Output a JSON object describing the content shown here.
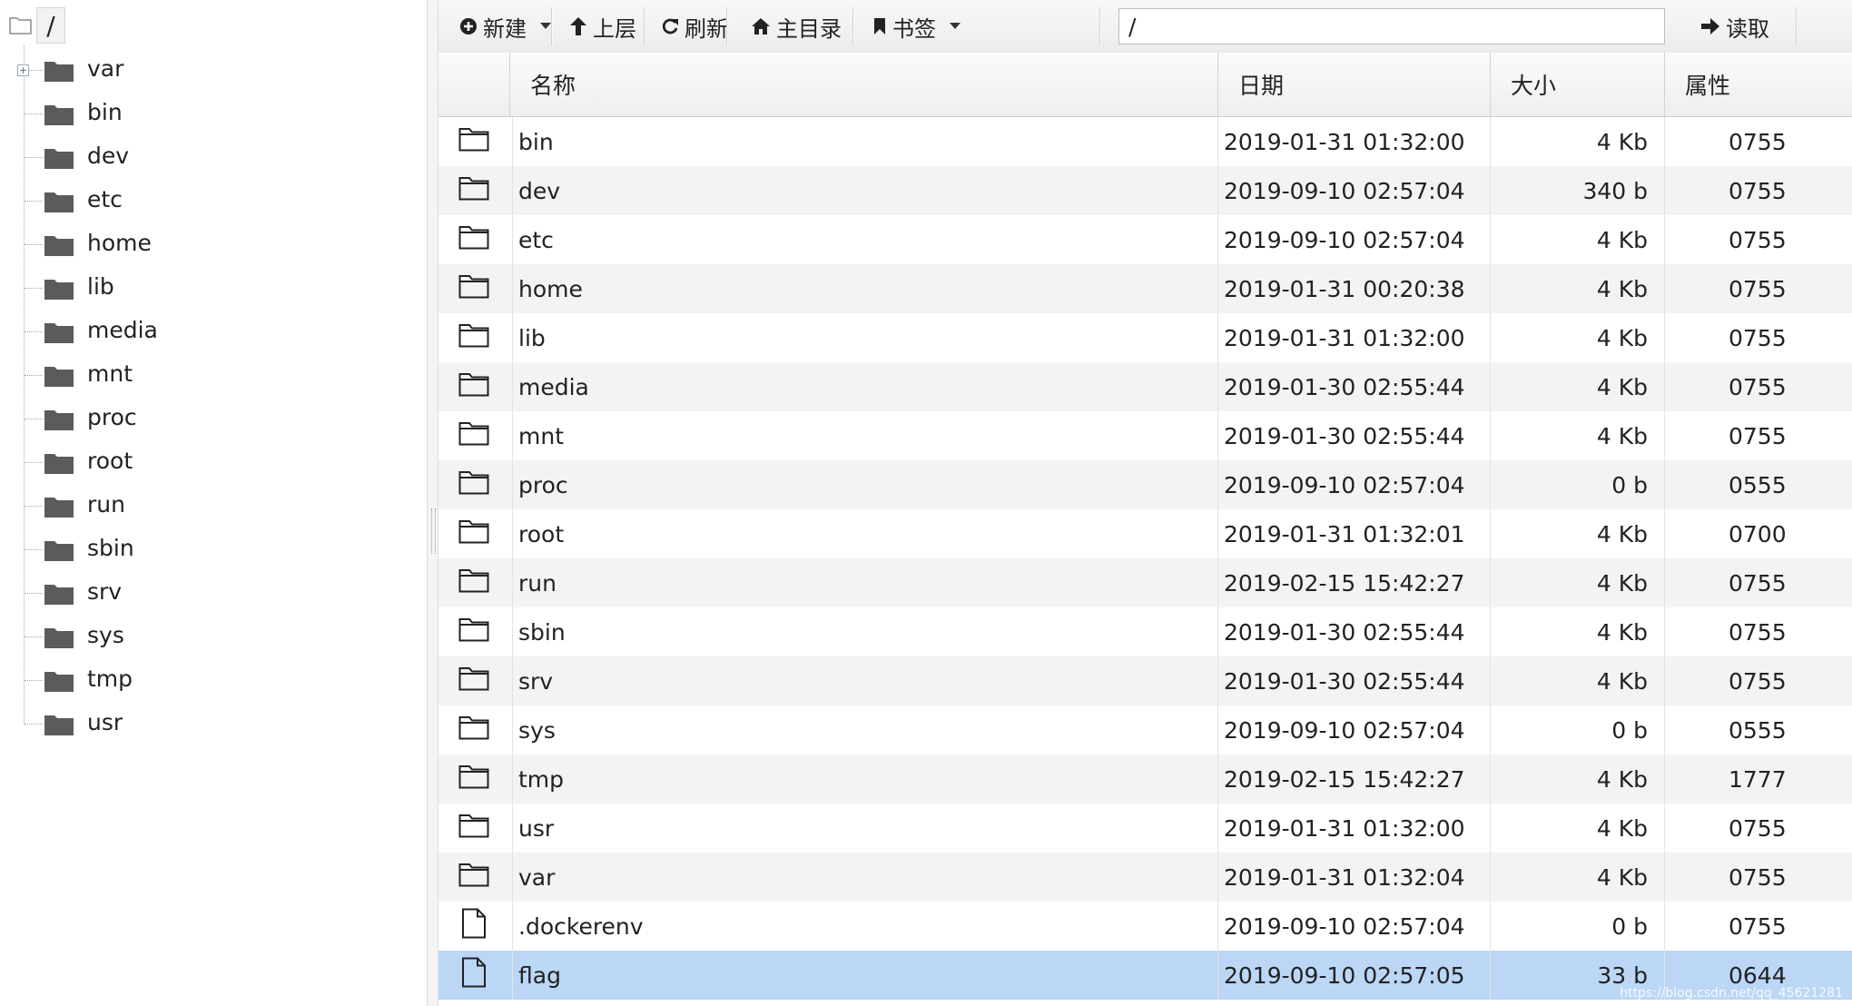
{
  "tree": {
    "root_label": "/",
    "items": [
      {
        "label": "var",
        "expandable": true
      },
      {
        "label": "bin"
      },
      {
        "label": "dev"
      },
      {
        "label": "etc"
      },
      {
        "label": "home"
      },
      {
        "label": "lib"
      },
      {
        "label": "media"
      },
      {
        "label": "mnt"
      },
      {
        "label": "proc"
      },
      {
        "label": "root"
      },
      {
        "label": "run"
      },
      {
        "label": "sbin"
      },
      {
        "label": "srv"
      },
      {
        "label": "sys"
      },
      {
        "label": "tmp"
      },
      {
        "label": "usr"
      }
    ]
  },
  "toolbar": {
    "new_label": "新建",
    "up_label": "上层",
    "refresh_label": "刷新",
    "home_label": "主目录",
    "bookmark_label": "书签",
    "path_value": "/",
    "read_label": "读取"
  },
  "grid": {
    "headers": {
      "name": "名称",
      "date": "日期",
      "size": "大小",
      "attr": "属性"
    },
    "rows": [
      {
        "type": "folder",
        "name": "bin",
        "date": "2019-01-31 01:32:00",
        "size": "4 Kb",
        "attr": "0755"
      },
      {
        "type": "folder",
        "name": "dev",
        "date": "2019-09-10 02:57:04",
        "size": "340 b",
        "attr": "0755"
      },
      {
        "type": "folder",
        "name": "etc",
        "date": "2019-09-10 02:57:04",
        "size": "4 Kb",
        "attr": "0755"
      },
      {
        "type": "folder",
        "name": "home",
        "date": "2019-01-31 00:20:38",
        "size": "4 Kb",
        "attr": "0755"
      },
      {
        "type": "folder",
        "name": "lib",
        "date": "2019-01-31 01:32:00",
        "size": "4 Kb",
        "attr": "0755"
      },
      {
        "type": "folder",
        "name": "media",
        "date": "2019-01-30 02:55:44",
        "size": "4 Kb",
        "attr": "0755"
      },
      {
        "type": "folder",
        "name": "mnt",
        "date": "2019-01-30 02:55:44",
        "size": "4 Kb",
        "attr": "0755"
      },
      {
        "type": "folder",
        "name": "proc",
        "date": "2019-09-10 02:57:04",
        "size": "0 b",
        "attr": "0555"
      },
      {
        "type": "folder",
        "name": "root",
        "date": "2019-01-31 01:32:01",
        "size": "4 Kb",
        "attr": "0700"
      },
      {
        "type": "folder",
        "name": "run",
        "date": "2019-02-15 15:42:27",
        "size": "4 Kb",
        "attr": "0755"
      },
      {
        "type": "folder",
        "name": "sbin",
        "date": "2019-01-30 02:55:44",
        "size": "4 Kb",
        "attr": "0755"
      },
      {
        "type": "folder",
        "name": "srv",
        "date": "2019-01-30 02:55:44",
        "size": "4 Kb",
        "attr": "0755"
      },
      {
        "type": "folder",
        "name": "sys",
        "date": "2019-09-10 02:57:04",
        "size": "0 b",
        "attr": "0555"
      },
      {
        "type": "folder",
        "name": "tmp",
        "date": "2019-02-15 15:42:27",
        "size": "4 Kb",
        "attr": "1777"
      },
      {
        "type": "folder",
        "name": "usr",
        "date": "2019-01-31 01:32:00",
        "size": "4 Kb",
        "attr": "0755"
      },
      {
        "type": "folder",
        "name": "var",
        "date": "2019-01-31 01:32:04",
        "size": "4 Kb",
        "attr": "0755"
      },
      {
        "type": "file",
        "name": ".dockerenv",
        "date": "2019-09-10 02:57:04",
        "size": "0 b",
        "attr": "0755"
      },
      {
        "type": "file",
        "name": "flag",
        "date": "2019-09-10 02:57:05",
        "size": "33 b",
        "attr": "0644",
        "selected": true
      }
    ]
  },
  "colors": {
    "selected_row": "#bcd7f6",
    "stripe": "#f3f3f3",
    "folder_fill": "#5b5b5b"
  },
  "watermark": "https://blog.csdn.net/qq_45621281"
}
